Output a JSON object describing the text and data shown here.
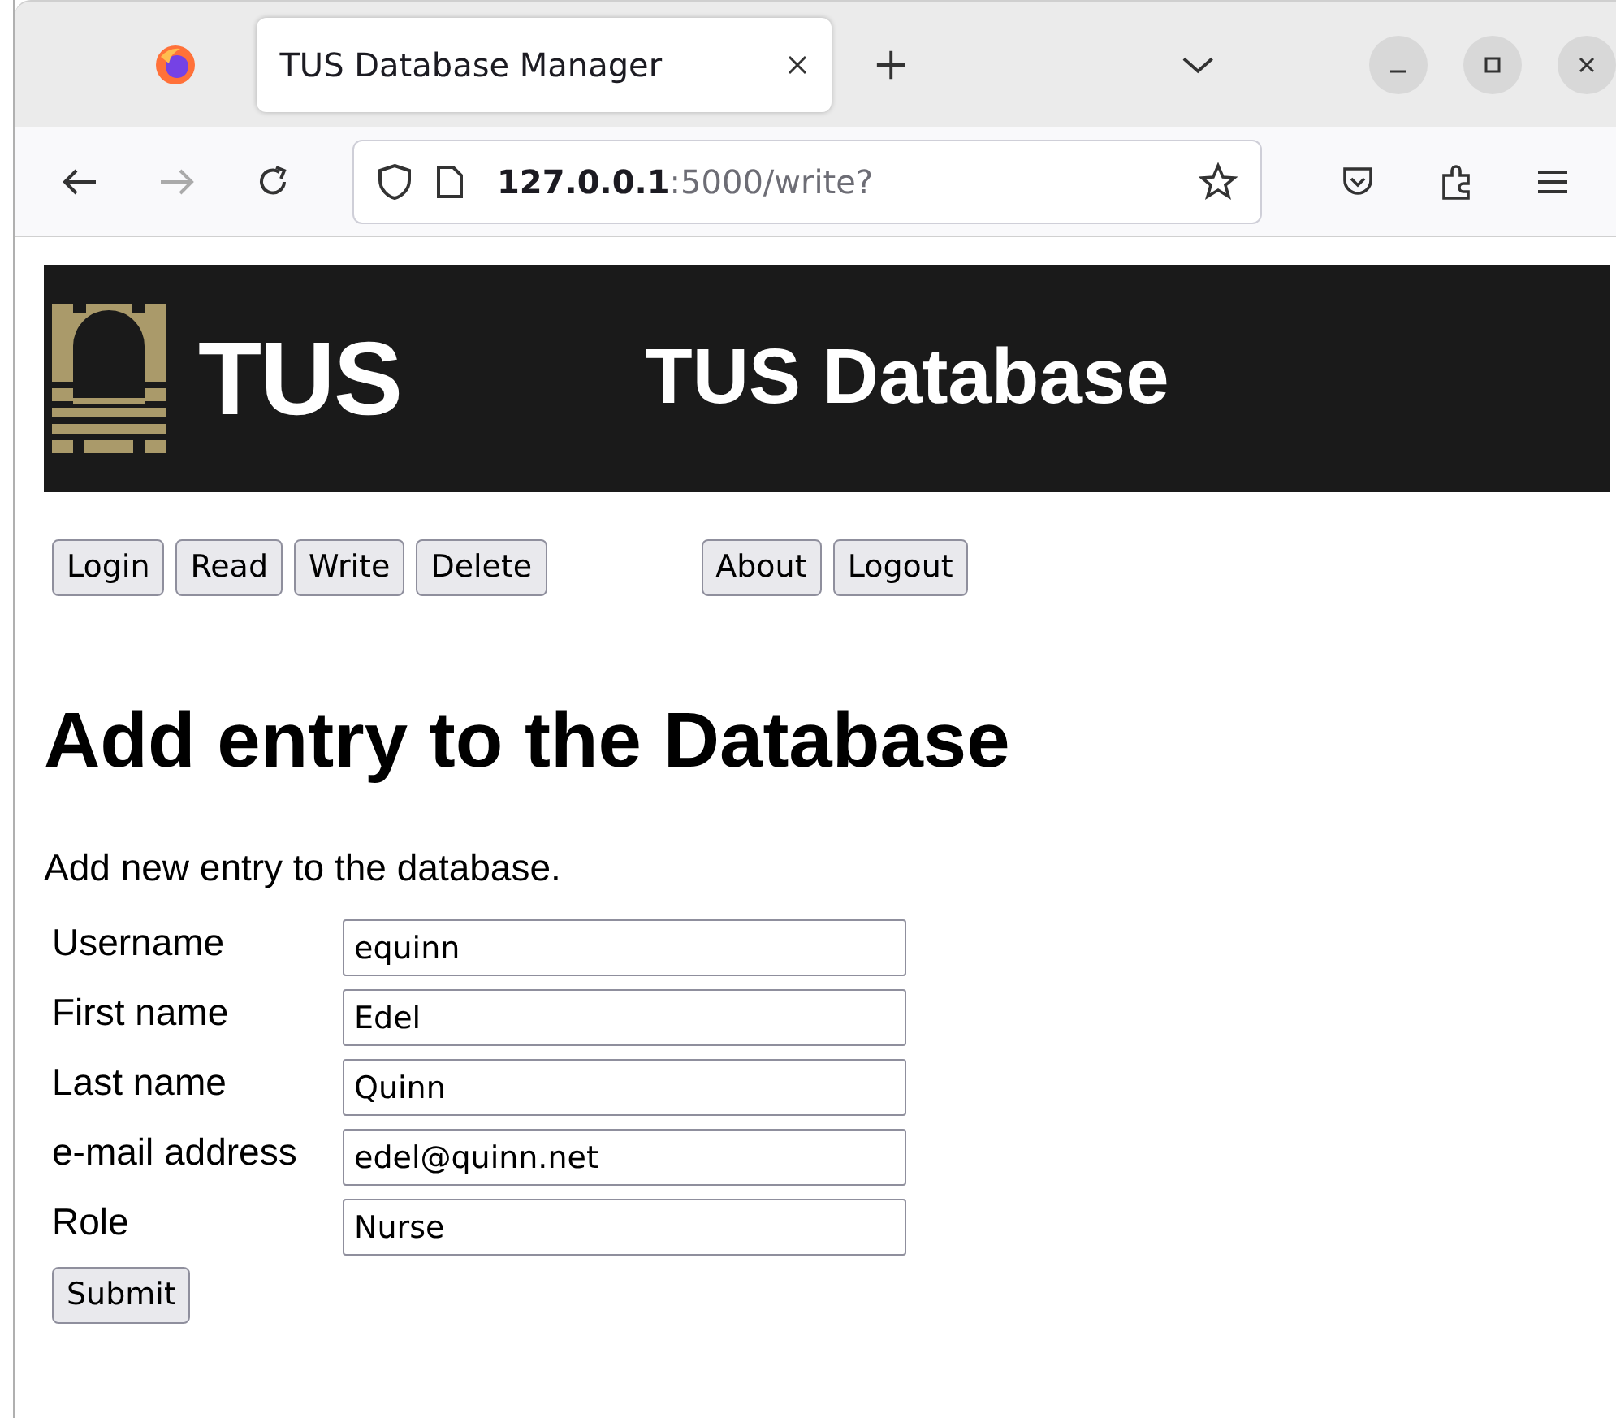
{
  "browser": {
    "tab_title": "TUS Database Manager",
    "url_host": "127.0.0.1",
    "url_path": ":5000/write?"
  },
  "banner": {
    "logo_text": "TUS",
    "title": "TUS Database"
  },
  "nav_buttons_left": [
    {
      "label": "Login"
    },
    {
      "label": "Read"
    },
    {
      "label": "Write"
    },
    {
      "label": "Delete"
    }
  ],
  "nav_buttons_right": [
    {
      "label": "About"
    },
    {
      "label": "Logout"
    }
  ],
  "heading": "Add entry to the Database",
  "intro": "Add new entry to the database.",
  "form": {
    "fields": [
      {
        "label": "Username",
        "value": "equinn"
      },
      {
        "label": "First name",
        "value": "Edel"
      },
      {
        "label": "Last name",
        "value": "Quinn"
      },
      {
        "label": "e-mail address",
        "value": "edel@quinn.net"
      },
      {
        "label": "Role",
        "value": "Nurse"
      }
    ],
    "submit": "Submit"
  }
}
